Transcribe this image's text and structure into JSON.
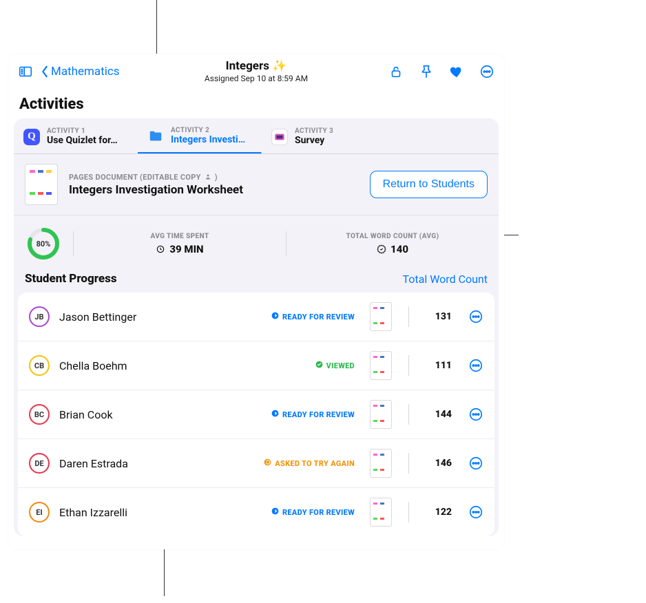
{
  "header": {
    "back_label": "Mathematics",
    "title": "Integers ✨",
    "assigned_prefix": "Assigned",
    "assigned_text": "Sep 10 at 8:59 AM"
  },
  "section_title": "Activities",
  "tabs": [
    {
      "overline": "ACTIVITY 1",
      "label": "Use Quizlet for…",
      "icon": "quizlet"
    },
    {
      "overline": "ACTIVITY 2",
      "label": "Integers Investi…",
      "icon": "folder",
      "active": true
    },
    {
      "overline": "ACTIVITY 3",
      "label": "Survey",
      "icon": "survey"
    }
  ],
  "document": {
    "overline": "PAGES DOCUMENT (EDITABLE COPY",
    "overline_suffix": ")",
    "title": "Integers Investigation Worksheet",
    "action_label": "Return to Students"
  },
  "metrics": {
    "ring_pct_text": "80%",
    "ring_pct": 80,
    "avg_time_label": "AVG TIME SPENT",
    "avg_time_value": "39 MIN",
    "word_count_label": "TOTAL WORD COUNT (AVG)",
    "word_count_value": "140"
  },
  "progress": {
    "title": "Student Progress",
    "link_label": "Total Word Count"
  },
  "status_labels": {
    "ready": "READY FOR REVIEW",
    "viewed": "VIEWED",
    "retry": "ASKED TO TRY AGAIN"
  },
  "students": [
    {
      "initials": "JB",
      "ring": "#a646d6",
      "name": "Jason Bettinger",
      "status": "ready",
      "count": "131"
    },
    {
      "initials": "CB",
      "ring": "#f2c40d",
      "name": "Chella Boehm",
      "status": "viewed",
      "count": "111"
    },
    {
      "initials": "BC",
      "ring": "#e8344f",
      "name": "Brian Cook",
      "status": "ready",
      "count": "144"
    },
    {
      "initials": "DE",
      "ring": "#e8344f",
      "name": "Daren Estrada",
      "status": "retry",
      "count": "146"
    },
    {
      "initials": "EI",
      "ring": "#f28a0d",
      "name": "Ethan Izzarelli",
      "status": "ready",
      "count": "122"
    }
  ]
}
